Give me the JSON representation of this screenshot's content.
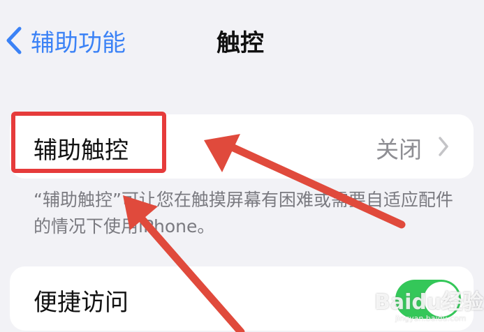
{
  "nav": {
    "back_label": "辅助功能",
    "title": "触控"
  },
  "assistive_touch": {
    "label": "辅助触控",
    "value": "关闭"
  },
  "footnote": "“辅助触控”可让您在触摸屏幕有困难或需要自适应配件的情况下使用iPhone。",
  "reachability": {
    "label": "便捷访问",
    "enabled": true
  },
  "annotation": {
    "color": "#e63b3b"
  },
  "watermark": {
    "brand": "Baidu经验",
    "url": "jingyan.baidu.com"
  },
  "colors": {
    "accent": "#3b82f6",
    "toggle_on": "#34c759",
    "background": "#f2f2f6"
  },
  "icons": [
    "chevron-left-icon",
    "chevron-right-icon"
  ]
}
